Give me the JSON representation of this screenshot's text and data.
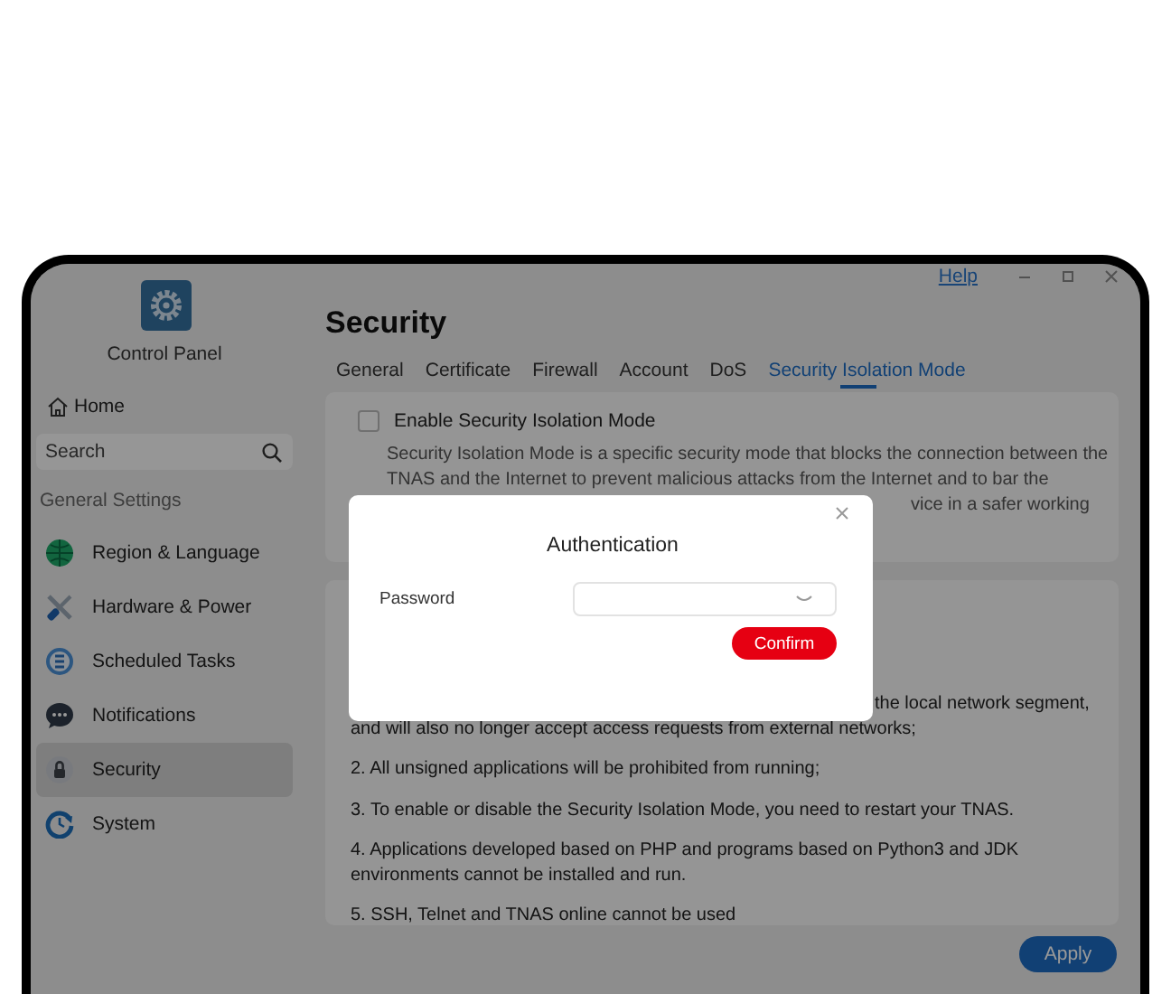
{
  "window": {
    "help_link": "Help"
  },
  "sidebar": {
    "app_title": "Control Panel",
    "home": "Home",
    "search": {
      "placeholder": "Search"
    },
    "section": "General Settings",
    "items": [
      {
        "label": "Region & Language",
        "selected": false
      },
      {
        "label": "Hardware & Power",
        "selected": false
      },
      {
        "label": "Scheduled Tasks",
        "selected": false
      },
      {
        "label": "Notifications",
        "selected": false
      },
      {
        "label": "Security",
        "selected": true
      },
      {
        "label": "System",
        "selected": false
      }
    ]
  },
  "page": {
    "title": "Security",
    "tabs": [
      {
        "label": "General",
        "selected": false
      },
      {
        "label": "Certificate",
        "selected": false
      },
      {
        "label": "Firewall",
        "selected": false
      },
      {
        "label": "Account",
        "selected": false
      },
      {
        "label": "DoS",
        "selected": false
      },
      {
        "label": "Security Isolation Mode",
        "selected": true
      }
    ],
    "isolation_card": {
      "checkbox": {
        "label": "Enable Security Isolation Mode",
        "checked": false
      },
      "description_lines": [
        "Security Isolation Mode is a specific security mode that blocks the connection between the",
        "TNAS and the Internet to prevent malicious attacks from the Internet and to bar the"
      ],
      "description_tail": "vice in a safer working"
    },
    "notes": {
      "first_line_tail": "the local network segment,",
      "paragraphs": [
        "and will also no longer accept access requests from external networks;",
        "2. All unsigned applications will be prohibited from running;",
        "3. To enable or disable the Security Isolation Mode, you need to restart your TNAS.",
        "4. Applications developed based on PHP and programs based on Python3 and JDK environments cannot be installed and run.",
        "5. SSH, Telnet and TNAS online cannot be used"
      ]
    },
    "apply_button": "Apply"
  },
  "dialog": {
    "title": "Authentication",
    "password": {
      "label": "Password"
    },
    "confirm_button": "Confirm"
  }
}
